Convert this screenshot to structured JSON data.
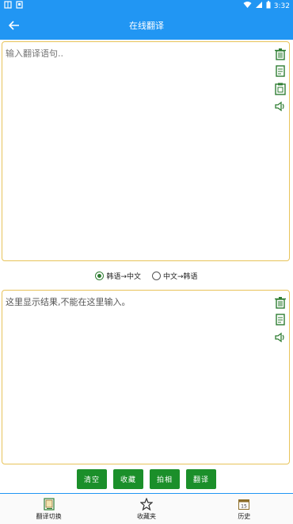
{
  "status_bar": {
    "time": "3:32",
    "left_icons": [
      "app-notification-icon",
      "image-notification-icon"
    ],
    "right_icons": [
      "wifi-icon",
      "signal-icon",
      "battery-icon"
    ]
  },
  "app_bar": {
    "title": "在线翻译"
  },
  "input": {
    "placeholder": "输入翻译语句.."
  },
  "direction": {
    "options": [
      "韩语→中文",
      "中文→韩语"
    ],
    "selected": "韩语→中文"
  },
  "output": {
    "text": "这里显示结果,不能在这里输入。"
  },
  "actions": {
    "clear": "清空",
    "favorite": "收藏",
    "photo": "拍相",
    "translate": "翻译"
  },
  "bottom_nav": {
    "items": [
      "翻译切换",
      "收藏夹",
      "历史"
    ],
    "calendar_day": "15"
  },
  "colors": {
    "primary": "#2196f3",
    "button": "#1b8f2a",
    "icon_green": "#2e7d32",
    "border": "#e8c35a"
  }
}
